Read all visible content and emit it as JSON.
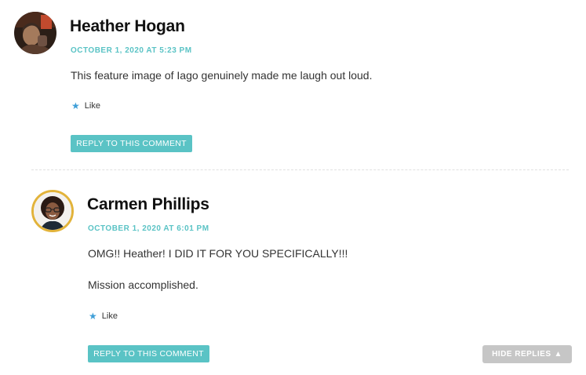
{
  "comments": [
    {
      "author": "Heather Hogan",
      "timestamp": "OCTOBER 1, 2020 AT 5:23 PM",
      "paragraphs": [
        "This feature image of Iago genuinely made me laugh out loud."
      ],
      "like_label": "Like",
      "reply_label": "REPLY TO THIS COMMENT",
      "avatar_icon": "avatar-photo-icon"
    },
    {
      "author": "Carmen Phillips",
      "timestamp": "OCTOBER 1, 2020 AT 6:01 PM",
      "paragraphs": [
        "OMG!! Heather! I DID IT FOR YOU SPECIFICALLY!!!",
        "Mission accomplished."
      ],
      "like_label": "Like",
      "reply_label": "REPLY TO THIS COMMENT",
      "avatar_icon": "avatar-photo-icon"
    }
  ],
  "hide_replies_label": "HIDE REPLIES",
  "hide_replies_icon": "triangle-up-icon",
  "colors": {
    "accent": "#5ac3c5",
    "star": "#3f9fd8",
    "hide_button": "#c6c6c6",
    "avatar_ring": "#e2b33a"
  }
}
